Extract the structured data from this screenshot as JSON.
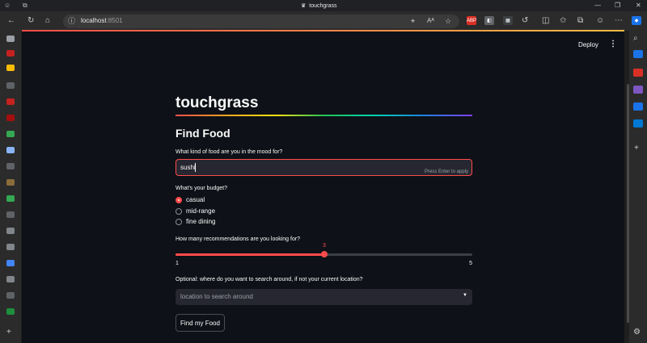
{
  "browser": {
    "tab_title": "touchgrass",
    "url_host": "localhost",
    "url_port": ":8501"
  },
  "app": {
    "deploy_label": "Deploy",
    "title": "touchgrass",
    "subtitle": "Find Food",
    "food_question": "What kind of food are you in the mood for?",
    "food_value": "sushi",
    "food_hint": "Press Enter to apply",
    "budget_label": "What's your budget?",
    "budget_options": [
      {
        "label": "casual",
        "selected": true
      },
      {
        "label": "mid-range",
        "selected": false
      },
      {
        "label": "fine dining",
        "selected": false
      }
    ],
    "recs_label": "How many recommendations are you looking for?",
    "slider": {
      "value": "3",
      "min": "1",
      "max": "5",
      "fraction": 0.5
    },
    "location_label": "Optional: where do you want to search around, if not your current location?",
    "location_placeholder": "location to search around",
    "submit_label": "Find my Food",
    "accent_color": "#ff4b4b"
  }
}
